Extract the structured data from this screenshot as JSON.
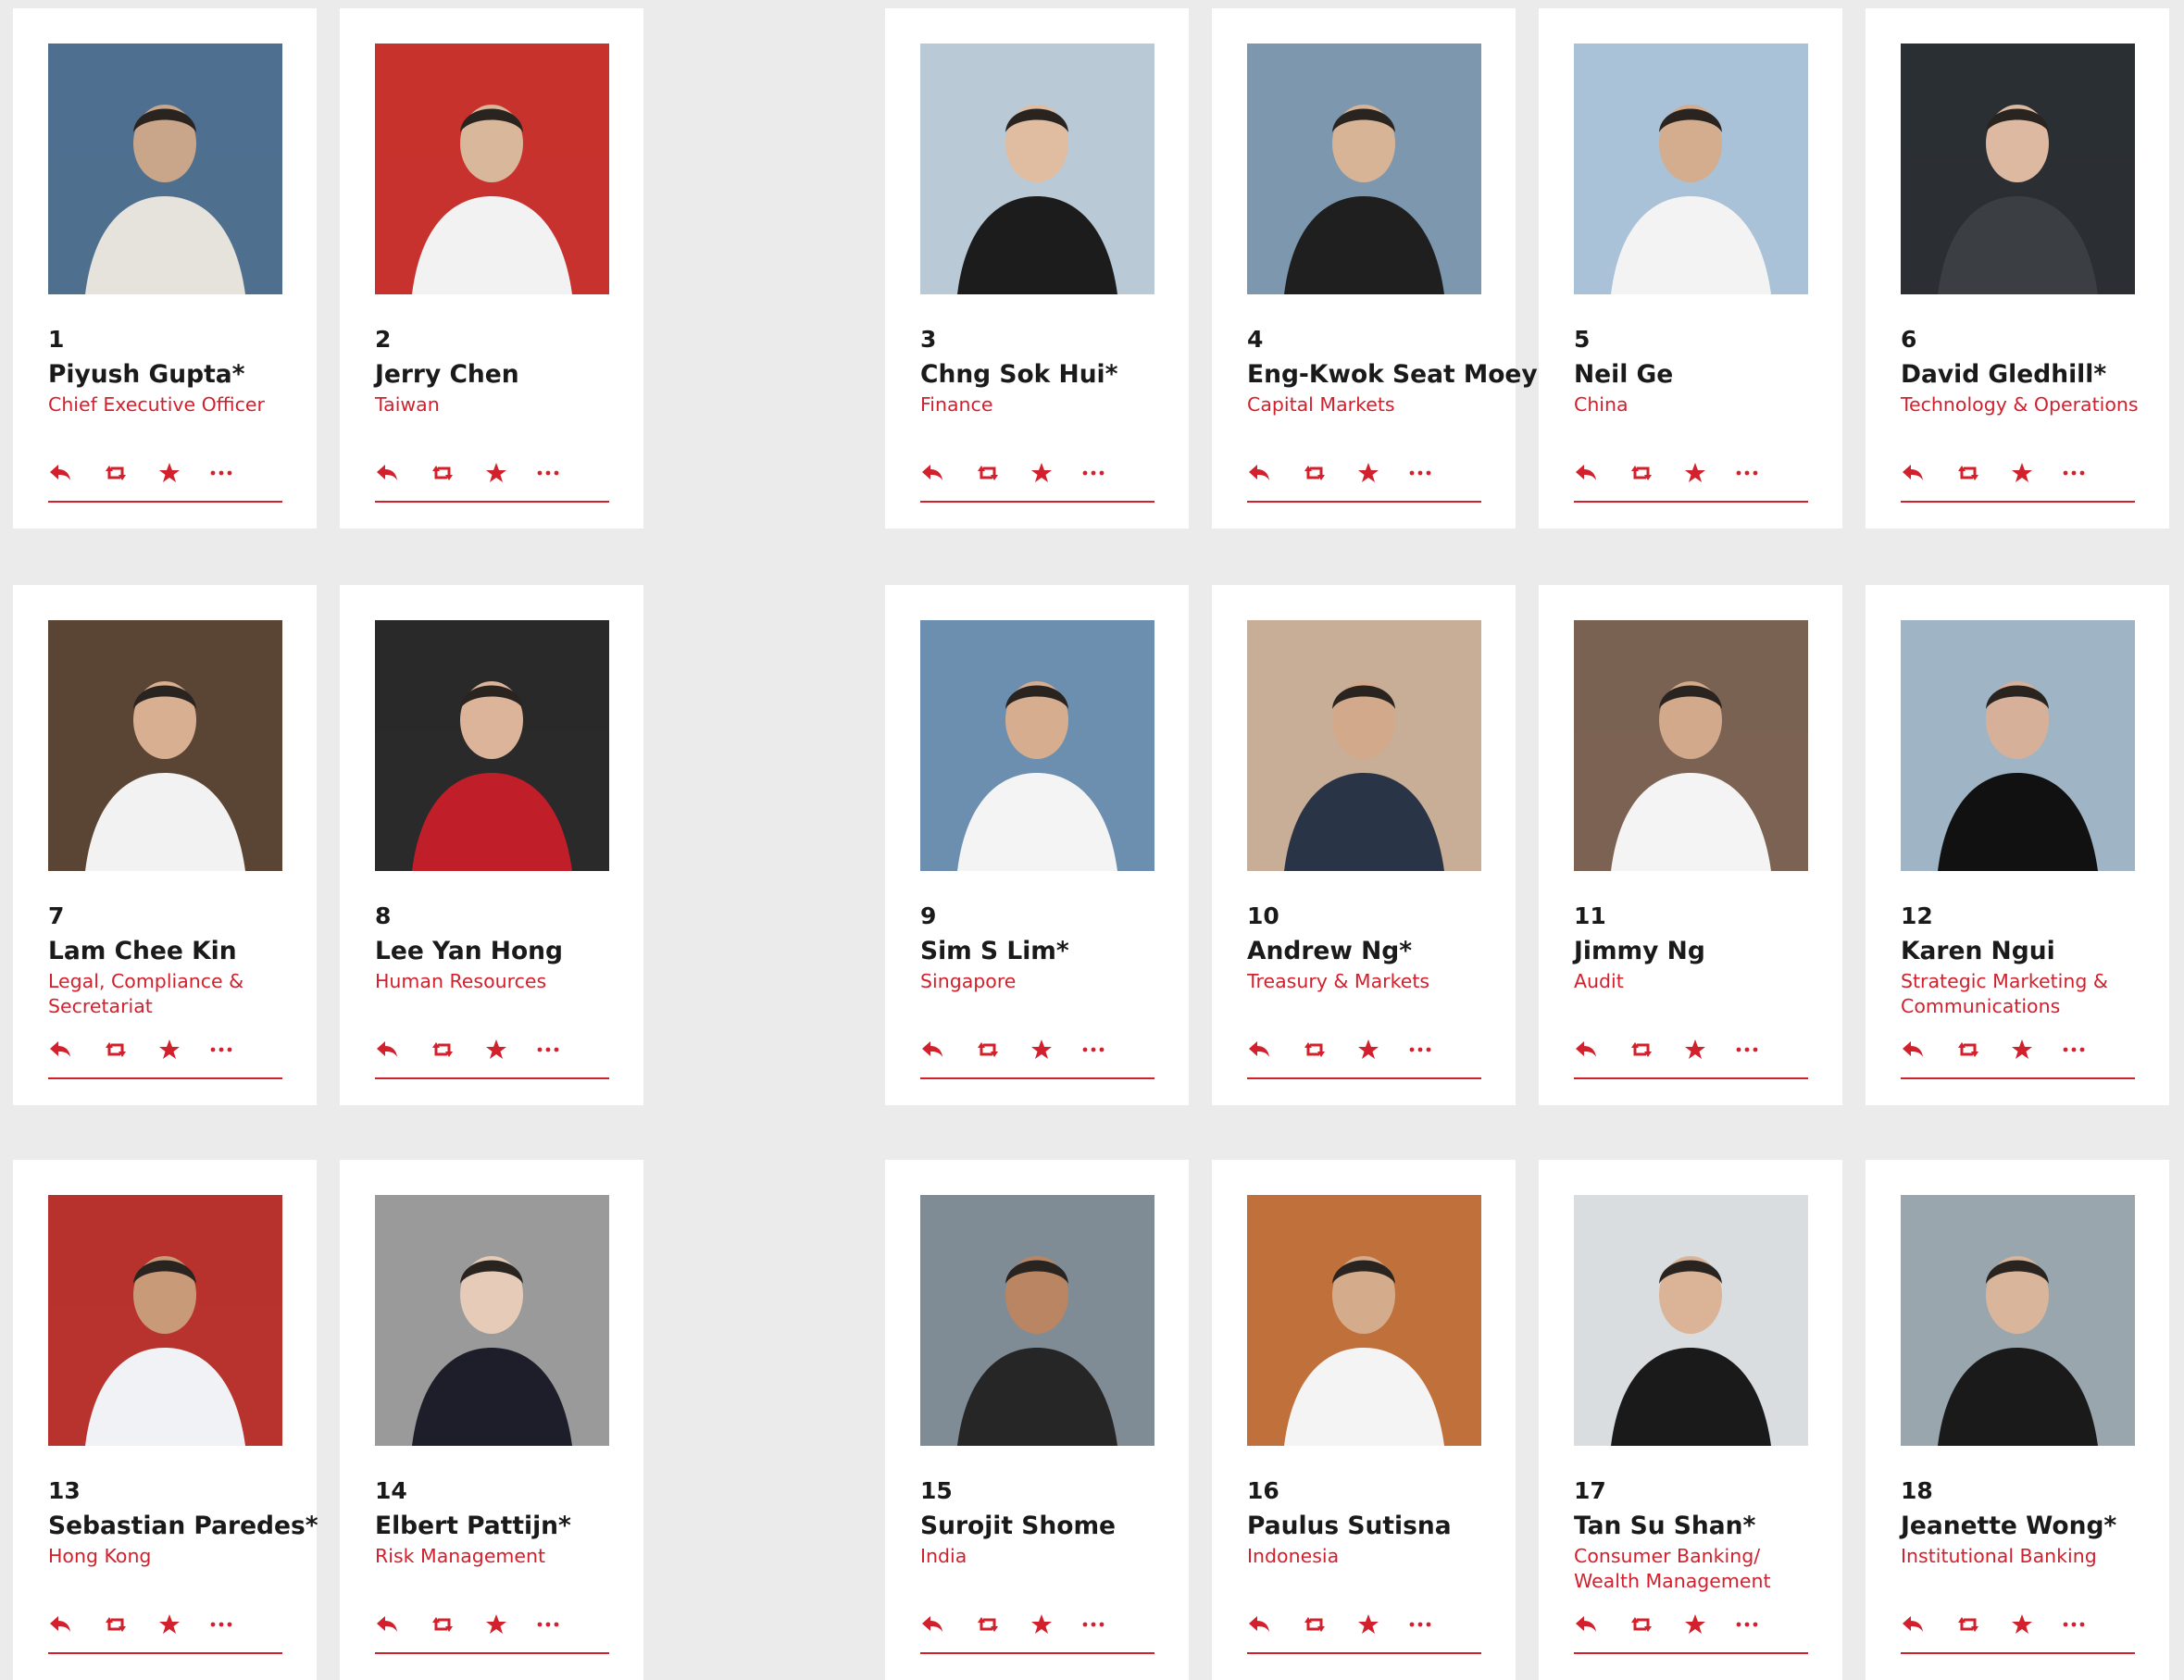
{
  "colors": {
    "accent": "#d2202d",
    "background": "#ebebeb",
    "card": "#ffffff",
    "text": "#1a1a1a"
  },
  "profiles": [
    {
      "number": "1",
      "name": "Piyush Gupta*",
      "role": "Chief Executive Officer"
    },
    {
      "number": "2",
      "name": "Jerry Chen",
      "role": "Taiwan"
    },
    {
      "number": "3",
      "name": "Chng Sok Hui*",
      "role": "Finance"
    },
    {
      "number": "4",
      "name": "Eng-Kwok Seat Moey",
      "role": "Capital Markets"
    },
    {
      "number": "5",
      "name": "Neil Ge",
      "role": "China"
    },
    {
      "number": "6",
      "name": "David Gledhill*",
      "role": "Technology & Operations"
    },
    {
      "number": "7",
      "name": "Lam Chee Kin",
      "role": "Legal, Compliance & Secretariat"
    },
    {
      "number": "8",
      "name": "Lee Yan Hong",
      "role": "Human Resources"
    },
    {
      "number": "9",
      "name": "Sim S Lim*",
      "role": "Singapore"
    },
    {
      "number": "10",
      "name": "Andrew Ng*",
      "role": "Treasury & Markets"
    },
    {
      "number": "11",
      "name": "Jimmy Ng",
      "role": "Audit"
    },
    {
      "number": "12",
      "name": "Karen Ngui",
      "role": "Strategic Marketing & Communications"
    },
    {
      "number": "13",
      "name": "Sebastian Paredes*",
      "role": "Hong Kong"
    },
    {
      "number": "14",
      "name": "Elbert Pattijn*",
      "role": "Risk Management"
    },
    {
      "number": "15",
      "name": "Surojit Shome",
      "role": "India"
    },
    {
      "number": "16",
      "name": "Paulus Sutisna",
      "role": "Indonesia"
    },
    {
      "number": "17",
      "name": "Tan Su Shan*",
      "role": "Consumer Banking/ Wealth Management"
    },
    {
      "number": "18",
      "name": "Jeanette Wong*",
      "role": "Institutional Banking"
    }
  ],
  "icons": {
    "reply": "reply-icon",
    "retweet": "retweet-icon",
    "favorite": "star-icon",
    "more": "more-icon"
  }
}
